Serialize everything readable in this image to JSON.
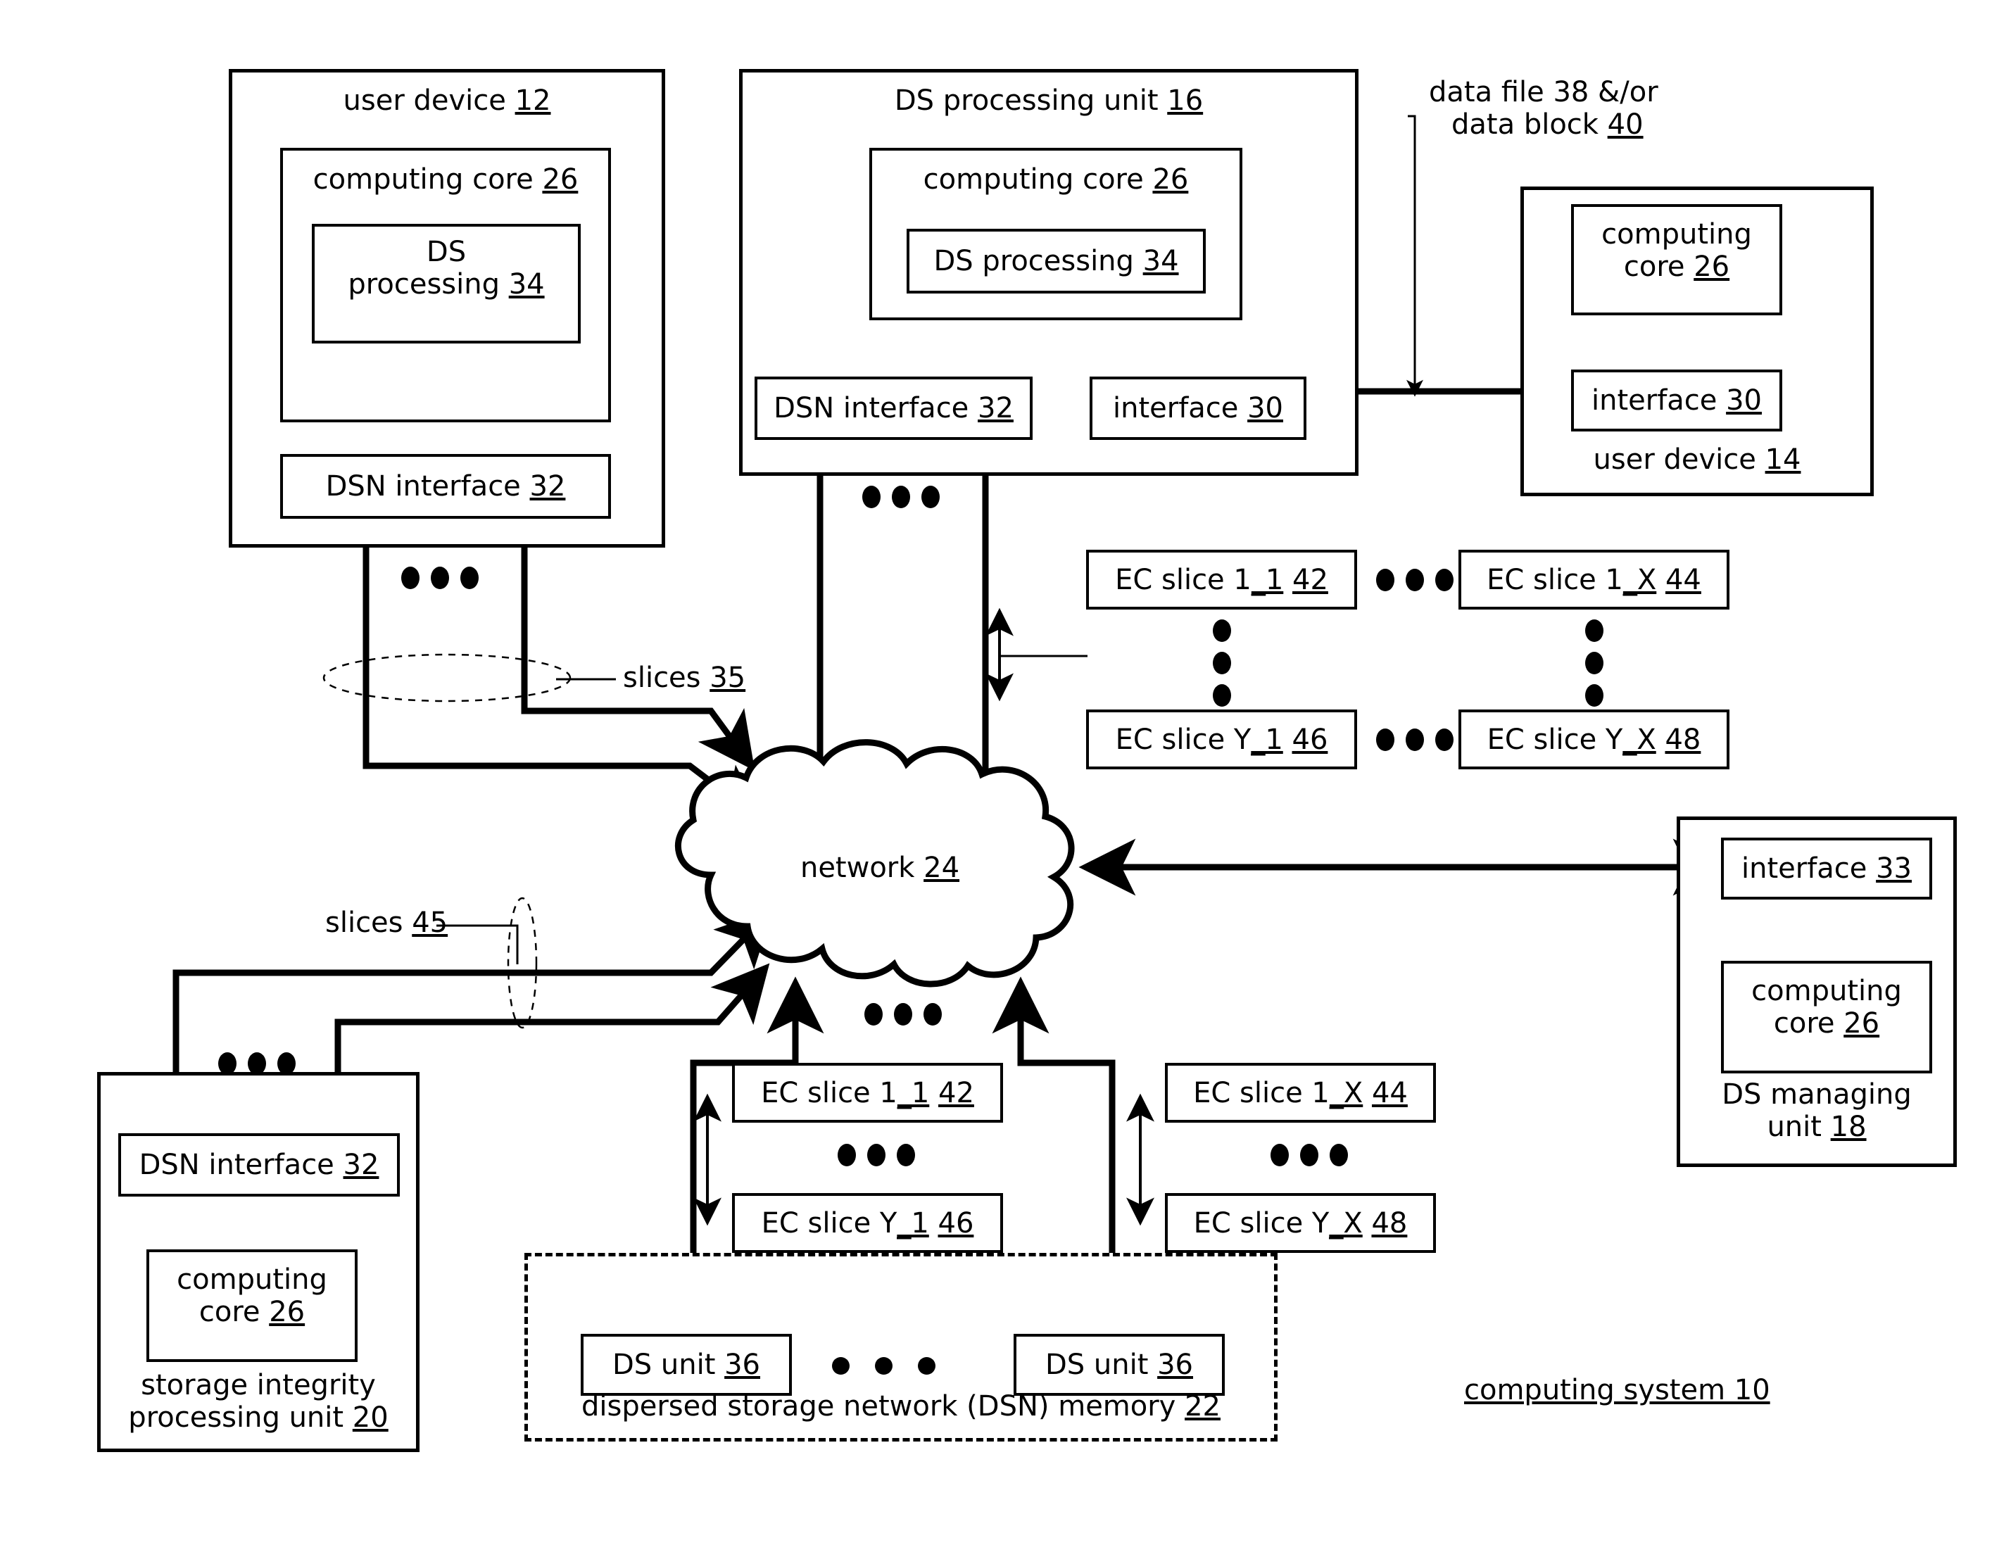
{
  "figure": {
    "system_label": "computing system 10",
    "network_label": "network 24",
    "data_flow_label_line1": "data file 38 &/or",
    "data_flow_label_line2": "data block 40",
    "slices_upper_label": "slices 35",
    "slices_lower_label": "slices 45"
  },
  "user_device_12": {
    "title": "user device 12",
    "computing_core": "computing core 26",
    "ds_processing_line1": "DS",
    "ds_processing_line2": "processing 34",
    "dsn_interface": "DSN interface 32"
  },
  "ds_processing_unit_16": {
    "title": "DS processing unit 16",
    "computing_core": "computing core 26",
    "ds_processing": "DS processing 34",
    "dsn_interface": "DSN interface 32",
    "interface": "interface 30"
  },
  "user_device_14": {
    "title": "user device 14",
    "computing_core_line1": "computing",
    "computing_core_line2": "core 26",
    "interface": "interface 30"
  },
  "ds_managing_unit_18": {
    "interface": "interface 33",
    "computing_core_line1": "computing",
    "computing_core_line2": "core 26",
    "title_line1": "DS managing",
    "title_line2": "unit 18"
  },
  "storage_integrity_unit_20": {
    "dsn_interface": "DSN interface 32",
    "computing_core_line1": "computing",
    "computing_core_line2": "core 26",
    "title_line1": "storage integrity",
    "title_line2": "processing unit 20"
  },
  "dsn_memory_22": {
    "title": "dispersed storage network (DSN) memory 22",
    "ds_unit_left": "DS unit 36",
    "ds_unit_right": "DS unit 36"
  },
  "ec_slices_upper": {
    "slice_1_1": "EC slice 1_1 42",
    "slice_1_X": "EC slice 1_X 44",
    "slice_Y_1": "EC slice Y_1 46",
    "slice_Y_X": "EC slice Y_X 48"
  },
  "ec_slices_lower": {
    "slice_1_1": "EC slice 1_1 42",
    "slice_1_X": "EC slice 1_X 44",
    "slice_Y_1": "EC slice Y_1 46",
    "slice_Y_X": "EC slice Y_X 48"
  },
  "colors": {
    "line": "#000000",
    "background": "#ffffff"
  }
}
